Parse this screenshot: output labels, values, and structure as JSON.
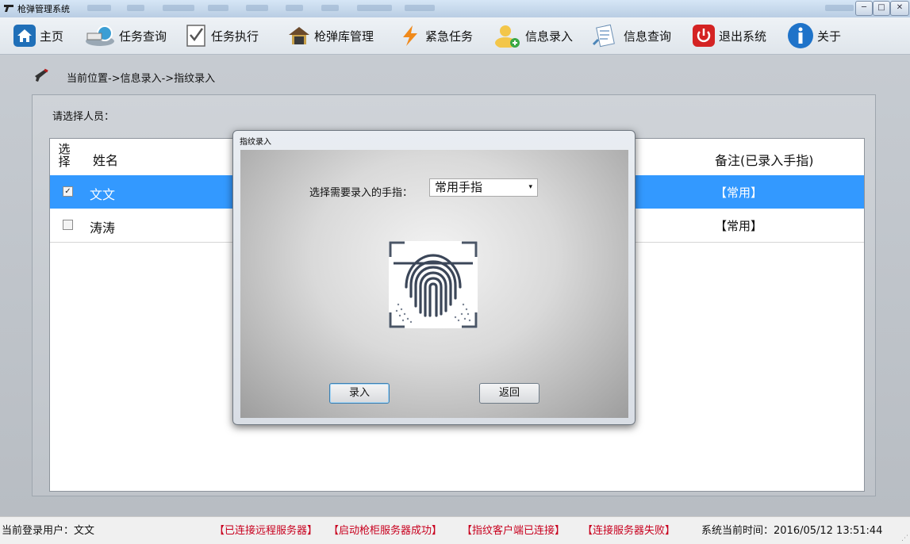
{
  "window": {
    "title": "枪弹管理系统",
    "controls": {
      "minimize": "─",
      "maximize": "□",
      "close": "✕"
    }
  },
  "toolbar": {
    "items": [
      {
        "label": "主页",
        "icon": "home-icon"
      },
      {
        "label": "任务查询",
        "icon": "task-query-icon"
      },
      {
        "label": "任务执行",
        "icon": "task-execute-icon"
      },
      {
        "label": "枪弹库管理",
        "icon": "armory-icon"
      },
      {
        "label": "紧急任务",
        "icon": "lightning-icon"
      },
      {
        "label": "信息录入",
        "icon": "user-add-icon"
      },
      {
        "label": "信息查询",
        "icon": "document-query-icon"
      },
      {
        "label": "退出系统",
        "icon": "power-icon"
      },
      {
        "label": "关于",
        "icon": "info-icon"
      }
    ]
  },
  "breadcrumb": "当前位置->信息录入->指纹录入",
  "main": {
    "select_label": "请选择人员：",
    "table": {
      "headers": {
        "select": "选择",
        "name": "姓名",
        "remark": "备注(已录入手指)"
      },
      "rows": [
        {
          "checked": true,
          "check_mark": "✓",
          "name": "文文",
          "remark": "【常用】"
        },
        {
          "checked": false,
          "check_mark": "",
          "name": "涛涛",
          "remark": "【常用】"
        }
      ]
    }
  },
  "dialog": {
    "title": "指纹录入",
    "finger_label": "选择需要录入的手指：",
    "finger_value": "常用手指",
    "finger_arrow": "▾",
    "enroll_button": "录入",
    "back_button": "返回"
  },
  "status": {
    "user": "当前登录用户：文文",
    "msg1": "【已连接远程服务器】",
    "msg2": "【启动枪柜服务器成功】",
    "msg3": "【指纹客户端已连接】",
    "msg4": "【连接服务器失败】",
    "time": "系统当前时间：2016/05/12 13:51:44"
  },
  "colors": {
    "selected_row": "#3399ff",
    "status_error": "#c8001e"
  }
}
